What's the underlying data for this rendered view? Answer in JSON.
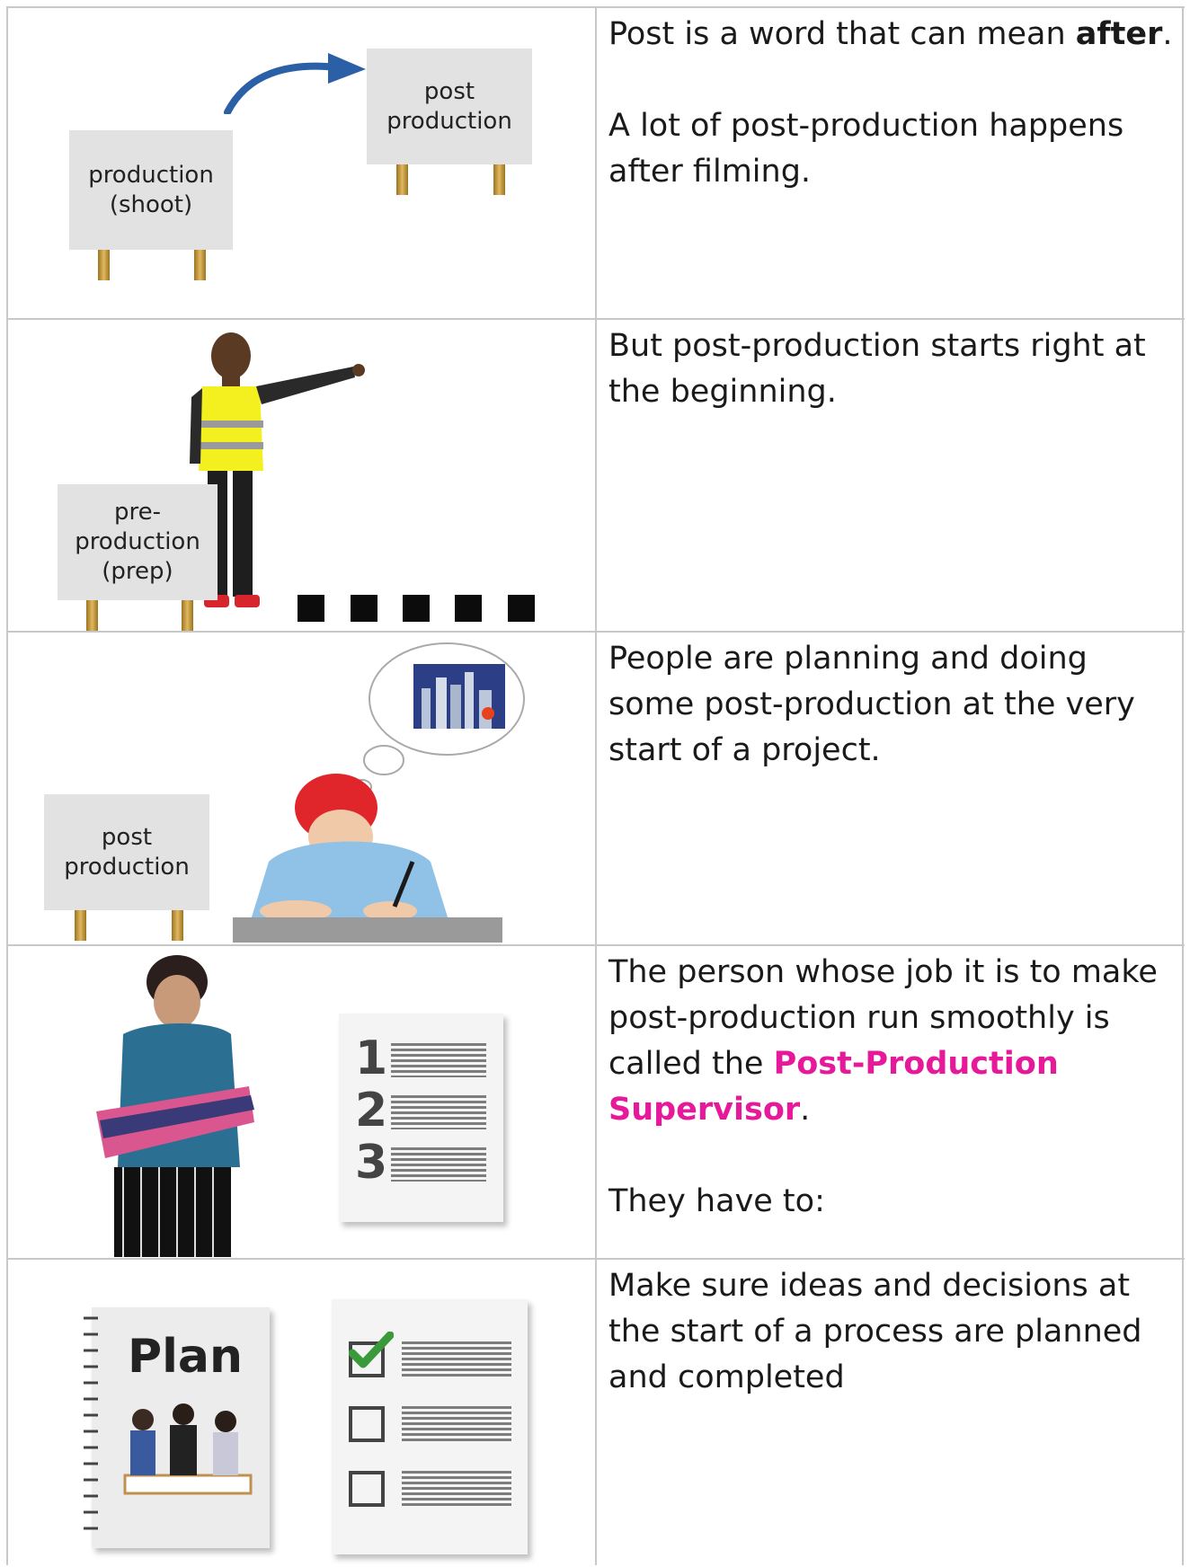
{
  "rows": [
    {
      "signs": {
        "production": "production\n(shoot)",
        "post": "post\nproduction"
      },
      "text": {
        "p1_before": "Post is a word that can mean ",
        "p1_bold": "after",
        "p1_after": ".",
        "p2": "A lot of post-production happens after filming."
      }
    },
    {
      "signs": {
        "pre": "pre-\nproduction\n(prep)"
      },
      "text": {
        "p1": "But post-production starts right at the beginning."
      }
    },
    {
      "signs": {
        "post": "post\nproduction"
      },
      "text": {
        "p1": "People are planning and doing some post-production at the very start of a project."
      }
    },
    {
      "list_numbers": [
        "1",
        "2",
        "3"
      ],
      "text": {
        "p1_before": "The person whose job it is to make post-production run smoothly is called the ",
        "p1_highlight": "Post-Production Supervisor",
        "p1_after": ".",
        "p2": "They have to:"
      }
    },
    {
      "plan_title": "Plan",
      "text": {
        "p1": "Make sure ideas and decisions at the start of a process are planned and completed"
      }
    }
  ],
  "colors": {
    "highlight": "#e6199b",
    "border": "#c8c8c8",
    "sign": "#e2e2e2"
  }
}
